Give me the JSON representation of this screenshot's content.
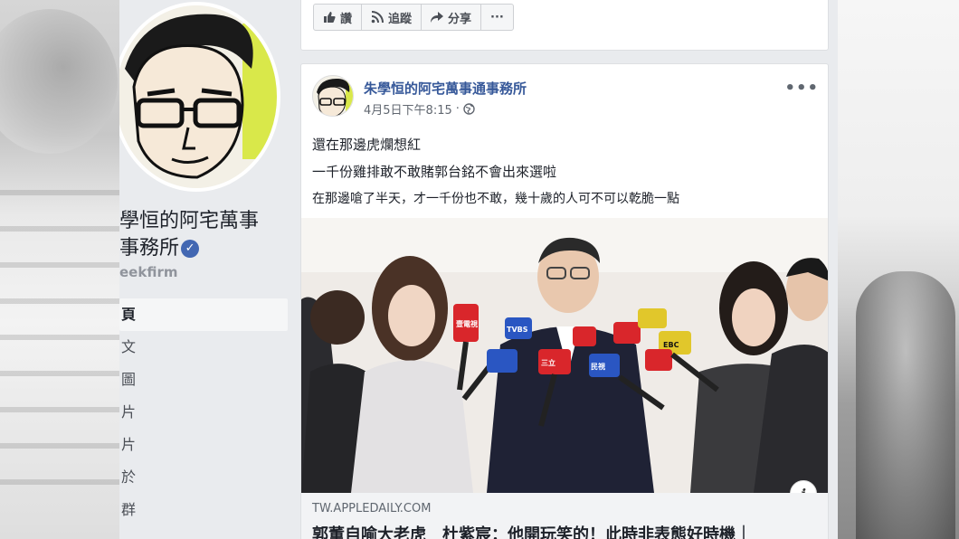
{
  "sidebar": {
    "page_name_line1": "學恒的阿宅萬事",
    "page_name_line2": "事務所",
    "handle": "eekfirm",
    "nav": [
      {
        "label": "頁",
        "active": true
      },
      {
        "label": "文",
        "active": false
      },
      {
        "label": "圖",
        "active": false
      },
      {
        "label": "片",
        "active": false
      },
      {
        "label": "片",
        "active": false
      },
      {
        "label": "於",
        "active": false
      },
      {
        "label": "群",
        "active": false
      }
    ]
  },
  "action_bar": {
    "like": "讚",
    "follow": "追蹤",
    "share": "分享",
    "more": "···"
  },
  "post": {
    "author": "朱學恒的阿宅萬事通事務所",
    "timestamp": "4月5日下午8:15",
    "privacy_icon": "globe-icon",
    "more": "•••",
    "lines": [
      "還在那邊虎爛想紅",
      "一千份雞排敢不敢賭郭台銘不會出來選啦",
      "在那邊嗆了半天，才一千份也不敢，幾十歲的人可不可以乾脆一點"
    ],
    "photo": {
      "mic_labels": [
        "壹電視",
        "TVBS",
        "三立",
        "EBC",
        "民視"
      ]
    },
    "info": "i",
    "link": {
      "domain": "TW.APPLEDAILY.COM",
      "title": "郭董自喻大老虎　杜紫宸：他開玩笑的！此時非表態好時機｜"
    }
  },
  "colors": {
    "link_blue": "#365899",
    "page_bg": "#e9ebee",
    "verified": "#4267b2"
  }
}
